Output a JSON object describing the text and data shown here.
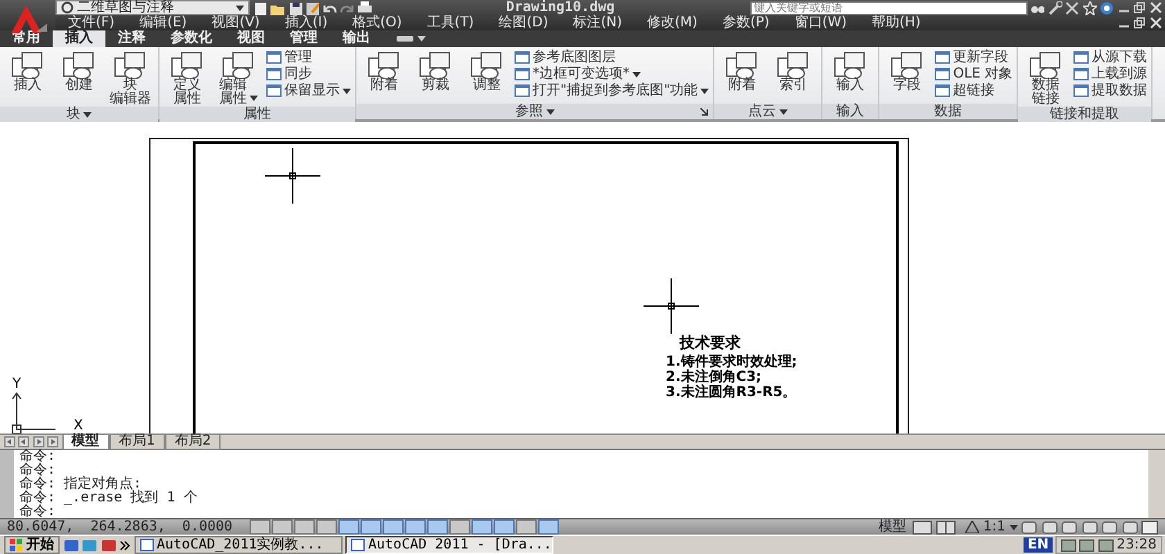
{
  "title_bar": {
    "workspace": "二维草图与注释",
    "title": "Drawing10.dwg",
    "search_placeholder": "键入关键字或短语"
  },
  "menu": [
    "文件(F)",
    "编辑(E)",
    "视图(V)",
    "插入(I)",
    "格式(O)",
    "工具(T)",
    "绘图(D)",
    "标注(N)",
    "修改(M)",
    "参数(P)",
    "窗口(W)",
    "帮助(H)"
  ],
  "ribbon_tabs": [
    {
      "label": "常用",
      "selected": false
    },
    {
      "label": "插入",
      "selected": true
    },
    {
      "label": "注释",
      "selected": false
    },
    {
      "label": "参数化",
      "selected": false
    },
    {
      "label": "视图",
      "selected": false
    },
    {
      "label": "管理",
      "selected": false
    },
    {
      "label": "输出",
      "selected": false
    }
  ],
  "ribbon_panels": [
    {
      "title": "块",
      "dropdown": true,
      "launcher": false,
      "large": [
        {
          "label": "插入",
          "dropdown": false
        },
        {
          "label": "创建",
          "dropdown": false
        },
        {
          "lines": [
            "块",
            "编辑器"
          ],
          "dropdown": false
        }
      ]
    },
    {
      "title": "属性",
      "dropdown": false,
      "launcher": false,
      "large": [
        {
          "lines": [
            "定义",
            "属性"
          ],
          "dropdown": false
        },
        {
          "lines": [
            "编辑",
            "属性"
          ],
          "dropdown": true
        }
      ],
      "small": [
        {
          "label": "管理",
          "dropdown": false
        },
        {
          "label": "同步",
          "dropdown": false
        },
        {
          "label": "保留显示",
          "dropdown": true
        }
      ]
    },
    {
      "title": "参照",
      "dropdown": true,
      "launcher": true,
      "large": [
        {
          "label": "附着",
          "dropdown": false
        },
        {
          "label": "剪裁",
          "dropdown": false
        },
        {
          "label": "调整",
          "dropdown": false
        }
      ],
      "small": [
        {
          "label": "参考底图图层",
          "dropdown": false
        },
        {
          "label": "*边框可变选项*",
          "dropdown": true
        },
        {
          "label": "打开\"捕捉到参考底图\"功能",
          "dropdown": true
        }
      ]
    },
    {
      "title": "点云",
      "dropdown": true,
      "launcher": false,
      "large": [
        {
          "label": "附着",
          "dropdown": false
        },
        {
          "label": "索引",
          "dropdown": false
        }
      ]
    },
    {
      "title": "输入",
      "dropdown": false,
      "launcher": false,
      "large": [
        {
          "label": "输入",
          "dropdown": false
        }
      ]
    },
    {
      "title": "数据",
      "dropdown": false,
      "launcher": false,
      "large": [
        {
          "label": "字段",
          "dropdown": false
        }
      ],
      "small": [
        {
          "label": "更新字段",
          "dropdown": false
        },
        {
          "label": "OLE 对象",
          "dropdown": false
        },
        {
          "label": "超链接",
          "dropdown": false
        }
      ]
    },
    {
      "title": "链接和提取",
      "dropdown": false,
      "launcher": false,
      "large": [
        {
          "lines": [
            "数据",
            "链接"
          ],
          "dropdown": false
        }
      ],
      "small": [
        {
          "label": "从源下载",
          "dropdown": false
        },
        {
          "label": "上载到源",
          "dropdown": false
        },
        {
          "label": "提取数据",
          "dropdown": false
        }
      ]
    }
  ],
  "drawing": {
    "notes_title": "技术要求",
    "notes": [
      "1.铸件要求时效处理;",
      "2.未注倒角C3;",
      "3.未注圆角R3-R5。"
    ],
    "ucs_y": "Y",
    "ucs_x": "X"
  },
  "layout_tabs": [
    {
      "label": "模型",
      "selected": true
    },
    {
      "label": "布局1",
      "selected": false
    },
    {
      "label": "布局2",
      "selected": false
    }
  ],
  "command_lines": [
    "命令:",
    "命令:",
    "命令: 指定对角点:",
    "命令: _.erase 找到 1 个",
    "命令:"
  ],
  "status_bar": {
    "coordinates": "80.6047,  264.2863,  0.0000",
    "toggles": [
      {
        "on": false
      },
      {
        "on": false
      },
      {
        "on": false
      },
      {
        "on": false
      },
      {
        "on": true
      },
      {
        "on": true
      },
      {
        "on": true
      },
      {
        "on": true
      },
      {
        "on": true
      },
      {
        "on": false
      },
      {
        "on": true
      },
      {
        "on": true
      },
      {
        "on": false
      },
      {
        "on": true
      }
    ],
    "space": "模型",
    "scale": "1:1"
  },
  "taskbar": {
    "start": "开始",
    "tasks": [
      {
        "label": "AutoCAD_2011实例教...",
        "selected": false
      },
      {
        "label": "AutoCAD 2011 - [Dra...",
        "selected": true
      }
    ],
    "language": "EN",
    "clock": "23:28"
  }
}
